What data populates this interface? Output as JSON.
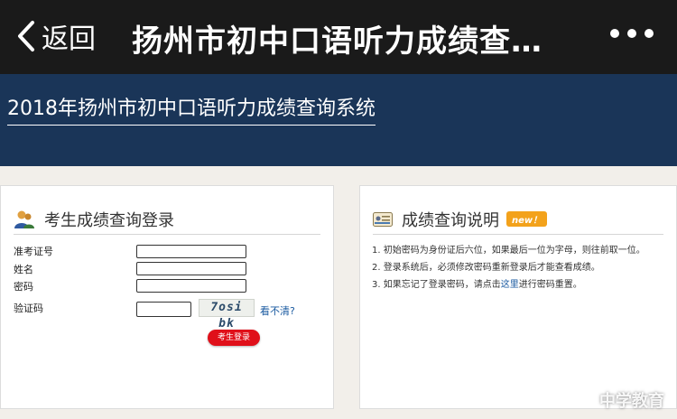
{
  "nav": {
    "back_label": "返回",
    "title": "扬州市初中口语听力成绩查…"
  },
  "banner": {
    "title": "2018年扬州市初中口语听力成绩查询系统"
  },
  "login": {
    "title": "考生成绩查询登录",
    "fields": [
      {
        "label": "准考证号",
        "value": ""
      },
      {
        "label": "姓名",
        "value": ""
      },
      {
        "label": "密码",
        "value": ""
      }
    ],
    "captcha_label": "验证码",
    "captcha_value": "",
    "captcha_text": "7osi bk",
    "captcha_refresh": "看不清?",
    "submit": "考生登录"
  },
  "info": {
    "title": "成绩查询说明",
    "badge": "new！",
    "notes": [
      "1. 初始密码为身份证后六位，如果最后一位为字母，则往前取一位。",
      "2. 登录系统后，必须修改密码重新登录后才能查看成绩。"
    ],
    "note3_prefix": "3. 如果忘记了登录密码，请点击",
    "note3_link": "这里",
    "note3_suffix": "进行密码重置。"
  },
  "watermark": "中学教育",
  "colors": {
    "navbar": "#1a1a1a",
    "banner": "#1a3558",
    "login_button": "#e0101a",
    "badge": "#f3a21b",
    "link": "#1a5aa0"
  }
}
